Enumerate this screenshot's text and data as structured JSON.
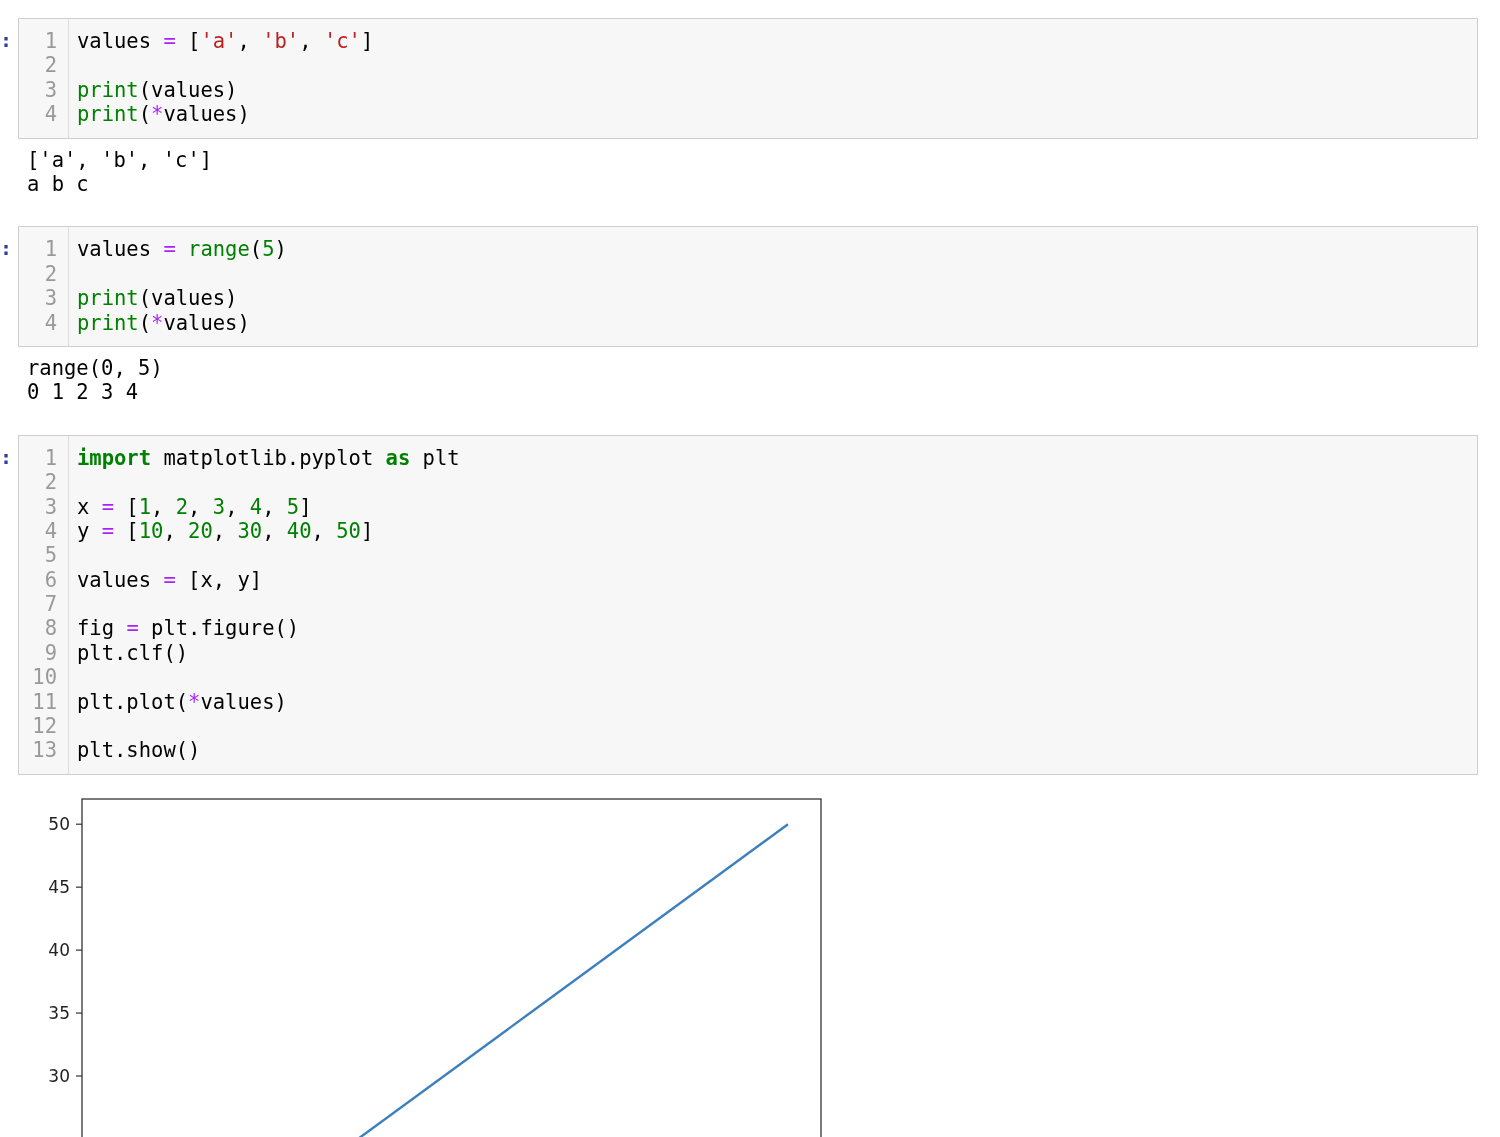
{
  "cells": [
    {
      "prompt": ":",
      "code": [
        {
          "number": "1",
          "tokens": [
            {
              "kind": "plain",
              "text": "values "
            },
            {
              "kind": "operator",
              "text": "="
            },
            {
              "kind": "plain",
              "text": " ["
            },
            {
              "kind": "string",
              "text": "'a'"
            },
            {
              "kind": "plain",
              "text": ", "
            },
            {
              "kind": "string",
              "text": "'b'"
            },
            {
              "kind": "plain",
              "text": ", "
            },
            {
              "kind": "string",
              "text": "'c'"
            },
            {
              "kind": "plain",
              "text": "]"
            }
          ]
        },
        {
          "number": "2"
        },
        {
          "number": "3",
          "tokens": [
            {
              "kind": "builtin",
              "text": "print"
            },
            {
              "kind": "plain",
              "text": "(values)"
            }
          ]
        },
        {
          "number": "4",
          "tokens": [
            {
              "kind": "builtin",
              "text": "print"
            },
            {
              "kind": "plain",
              "text": "("
            },
            {
              "kind": "operator",
              "text": "*"
            },
            {
              "kind": "plain",
              "text": "values)"
            }
          ]
        }
      ],
      "output": {
        "kind": "text",
        "lines": [
          "['a', 'b', 'c']",
          "a b c"
        ]
      }
    },
    {
      "prompt": ":",
      "code": [
        {
          "number": "1",
          "tokens": [
            {
              "kind": "plain",
              "text": "values "
            },
            {
              "kind": "operator",
              "text": "= "
            },
            {
              "kind": "builtin",
              "text": "range"
            },
            {
              "kind": "plain",
              "text": "("
            },
            {
              "kind": "number",
              "text": "5"
            },
            {
              "kind": "plain",
              "text": ")"
            }
          ]
        },
        {
          "number": "2"
        },
        {
          "number": "3",
          "tokens": [
            {
              "kind": "builtin",
              "text": "print"
            },
            {
              "kind": "plain",
              "text": "(values)"
            }
          ]
        },
        {
          "number": "4",
          "tokens": [
            {
              "kind": "builtin",
              "text": "print"
            },
            {
              "kind": "plain",
              "text": "("
            },
            {
              "kind": "operator",
              "text": "*"
            },
            {
              "kind": "plain",
              "text": "values)"
            }
          ]
        }
      ],
      "output": {
        "kind": "text",
        "lines": [
          "range(0, 5)",
          "0 1 2 3 4"
        ]
      }
    },
    {
      "prompt": ":",
      "code": [
        {
          "number": "1",
          "tokens": [
            {
              "kind": "keyword",
              "text": "import"
            },
            {
              "kind": "plain",
              "text": " matplotlib.pyplot "
            },
            {
              "kind": "keyword",
              "text": "as"
            },
            {
              "kind": "plain",
              "text": " plt"
            }
          ]
        },
        {
          "number": "2"
        },
        {
          "number": "3",
          "tokens": [
            {
              "kind": "plain",
              "text": "x "
            },
            {
              "kind": "operator",
              "text": "="
            },
            {
              "kind": "plain",
              "text": " ["
            },
            {
              "kind": "number",
              "text": "1"
            },
            {
              "kind": "plain",
              "text": ", "
            },
            {
              "kind": "number",
              "text": "2"
            },
            {
              "kind": "plain",
              "text": ", "
            },
            {
              "kind": "number",
              "text": "3"
            },
            {
              "kind": "plain",
              "text": ", "
            },
            {
              "kind": "number",
              "text": "4"
            },
            {
              "kind": "plain",
              "text": ", "
            },
            {
              "kind": "number",
              "text": "5"
            },
            {
              "kind": "plain",
              "text": "]"
            }
          ]
        },
        {
          "number": "4",
          "tokens": [
            {
              "kind": "plain",
              "text": "y "
            },
            {
              "kind": "operator",
              "text": "="
            },
            {
              "kind": "plain",
              "text": " ["
            },
            {
              "kind": "number",
              "text": "10"
            },
            {
              "kind": "plain",
              "text": ", "
            },
            {
              "kind": "number",
              "text": "20"
            },
            {
              "kind": "plain",
              "text": ", "
            },
            {
              "kind": "number",
              "text": "30"
            },
            {
              "kind": "plain",
              "text": ", "
            },
            {
              "kind": "number",
              "text": "40"
            },
            {
              "kind": "plain",
              "text": ", "
            },
            {
              "kind": "number",
              "text": "50"
            },
            {
              "kind": "plain",
              "text": "]"
            }
          ]
        },
        {
          "number": "5"
        },
        {
          "number": "6",
          "tokens": [
            {
              "kind": "plain",
              "text": "values "
            },
            {
              "kind": "operator",
              "text": "="
            },
            {
              "kind": "plain",
              "text": " [x, y]"
            }
          ]
        },
        {
          "number": "7"
        },
        {
          "number": "8",
          "tokens": [
            {
              "kind": "plain",
              "text": "fig "
            },
            {
              "kind": "operator",
              "text": "="
            },
            {
              "kind": "plain",
              "text": " plt.figure()"
            }
          ]
        },
        {
          "number": "9",
          "tokens": [
            {
              "kind": "plain",
              "text": "plt.clf()"
            }
          ]
        },
        {
          "number": "10"
        },
        {
          "number": "11",
          "tokens": [
            {
              "kind": "plain",
              "text": "plt.plot("
            },
            {
              "kind": "operator",
              "text": "*"
            },
            {
              "kind": "plain",
              "text": "values)"
            }
          ]
        },
        {
          "number": "12"
        },
        {
          "number": "13",
          "tokens": [
            {
              "kind": "plain",
              "text": "plt.show()"
            }
          ]
        }
      ],
      "output": {
        "kind": "plot",
        "y_tick_labels": [
          "50",
          "45",
          "40",
          "35",
          "30"
        ]
      }
    }
  ]
}
